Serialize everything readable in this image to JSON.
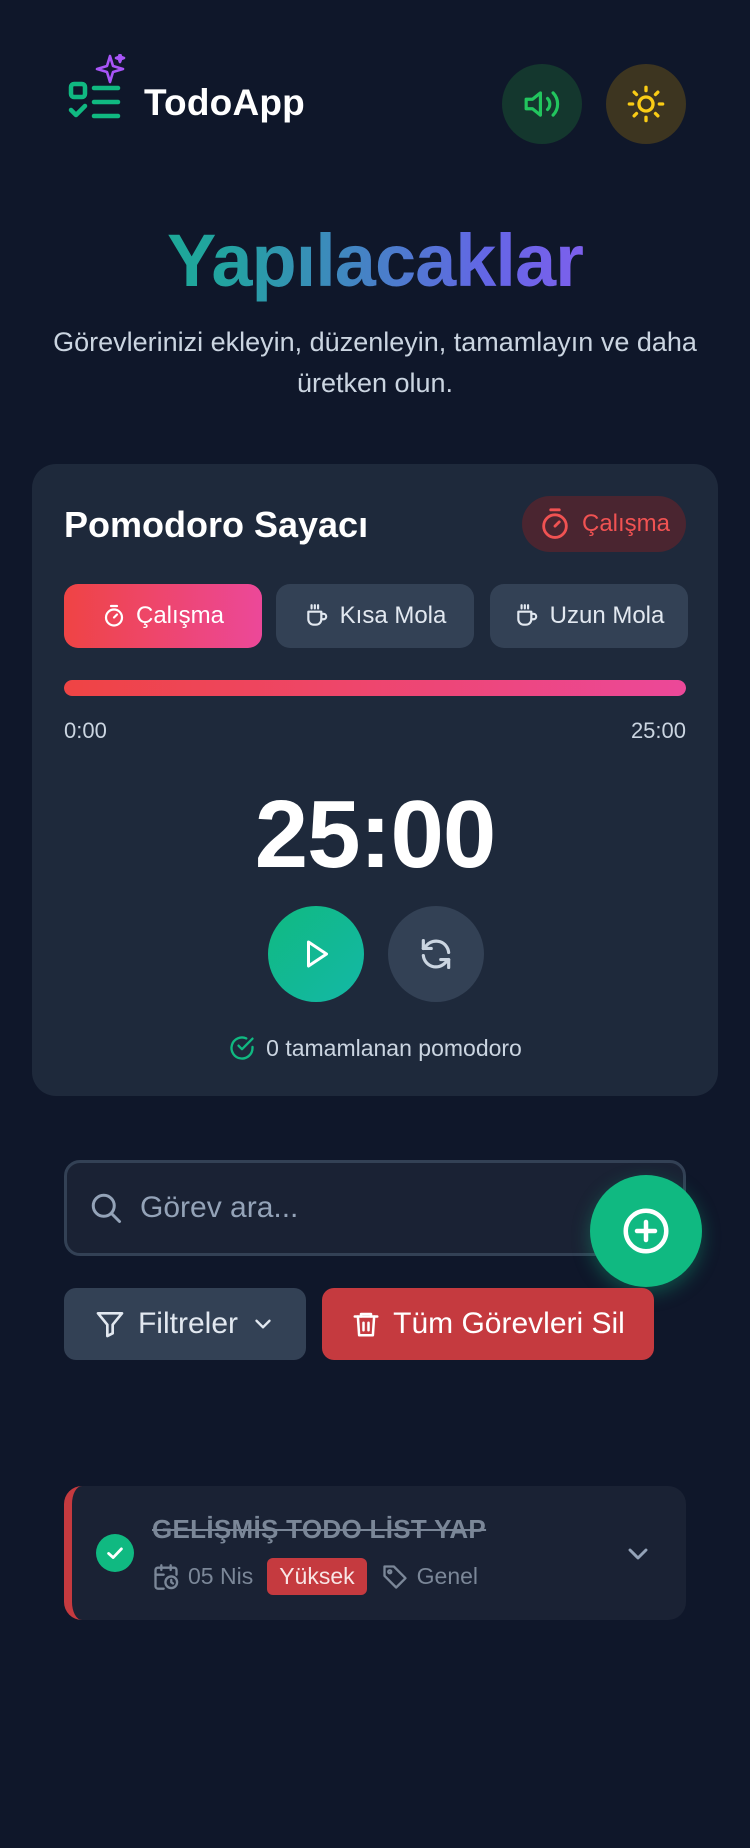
{
  "header": {
    "brand": "TodoApp",
    "sound_icon": "speaker-icon",
    "theme_icon": "sun-icon"
  },
  "hero": {
    "title": "Yapılacaklar",
    "subtitle": "Görevlerinizi ekleyin, düzenleyin, tamamlayın ve daha üretken olun."
  },
  "pomodoro": {
    "title": "Pomodoro Sayacı",
    "mode_badge": "Çalışma",
    "tabs": [
      {
        "label": "Çalışma",
        "icon": "timer-icon",
        "active": true
      },
      {
        "label": "Kısa Mola",
        "icon": "coffee-icon",
        "active": false
      },
      {
        "label": "Uzun Mola",
        "icon": "coffee-icon",
        "active": false
      }
    ],
    "progress": 1.0,
    "time_start": "0:00",
    "time_end": "25:00",
    "timer": "25:00",
    "completed_text": "0 tamamlanan pomodoro"
  },
  "search": {
    "placeholder": "Görev ara..."
  },
  "actions": {
    "filters_label": "Filtreler",
    "delete_all_label": "Tüm Görevleri Sil"
  },
  "todos": [
    {
      "title": "GELİŞMİŞ TODO LİST YAP",
      "date": "05 Nis",
      "priority": "Yüksek",
      "category": "Genel",
      "completed": true
    }
  ],
  "colors": {
    "background": "#0f172a",
    "card": "#1e293b",
    "accent_green": "#10b981",
    "accent_red": "#ef4444",
    "accent_pink": "#ec4899",
    "purple": "#a855f7"
  }
}
